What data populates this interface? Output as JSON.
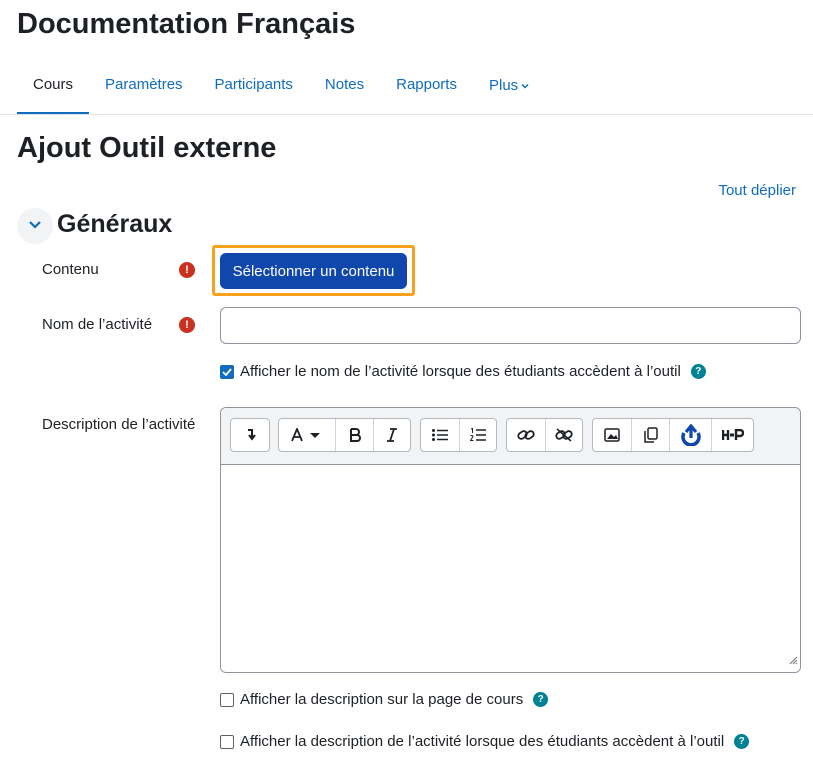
{
  "course": {
    "title": "Documentation Français"
  },
  "nav": {
    "tabs": [
      {
        "label": "Cours"
      },
      {
        "label": "Paramètres"
      },
      {
        "label": "Participants"
      },
      {
        "label": "Notes"
      },
      {
        "label": "Rapports"
      },
      {
        "label": "Plus"
      }
    ],
    "active_tab": "Cours"
  },
  "page": {
    "title": "Ajout Outil externe",
    "expand_all": "Tout déplier"
  },
  "section": {
    "title": "Généraux",
    "toggle_icon": "chevron-down-icon"
  },
  "form": {
    "content": {
      "label": "Contenu",
      "required_icon": "!",
      "button_label": "Sélectionner un contenu"
    },
    "activity_name": {
      "label": "Nom de l’activité",
      "required_icon": "!",
      "value": "",
      "placeholder": ""
    },
    "show_name": {
      "label": "Afficher le nom de l’activité lorsque des étudiants accèdent à l’outil",
      "checked": true,
      "help_icon": "?"
    },
    "description": {
      "label": "Description de l’activité",
      "value": "",
      "toolbar_groups": [
        [
          "collapse-icon"
        ],
        [
          "font-style-icon",
          "bold-icon",
          "italic-icon"
        ],
        [
          "unordered-list-icon",
          "ordered-list-icon"
        ],
        [
          "link-icon",
          "unlink-icon"
        ],
        [
          "image-icon",
          "media-icon",
          "record-icon",
          "h5p-icon"
        ]
      ]
    },
    "show_description_course": {
      "label": "Afficher la description sur la page de cours",
      "checked": false,
      "help_icon": "?"
    },
    "show_description_tool": {
      "label": "Afficher la description de l’activité lorsque des étudiants accèdent à l’outil",
      "checked": false,
      "help_icon": "?"
    }
  },
  "colors": {
    "accent": "#0f6cbf",
    "primary_button": "#0f47ad",
    "focus": "#f7a11d",
    "required": "#ca3120",
    "help": "#008196"
  }
}
